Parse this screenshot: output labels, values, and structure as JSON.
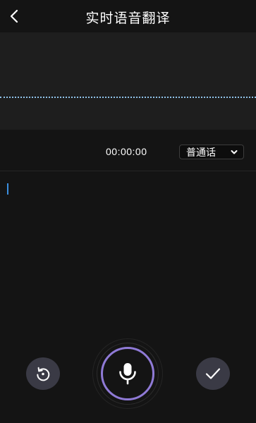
{
  "header": {
    "title": "实时语音翻译",
    "back_icon": "chevron-left-icon"
  },
  "waveform": {
    "color": "#8fc3ea"
  },
  "recorder": {
    "timer": "00:00:00",
    "language": "普通话",
    "language_chevron": "chevron-down-icon"
  },
  "transcript": {
    "text": "",
    "cursor_color": "#3b8fe0"
  },
  "controls": {
    "reset_icon": "reset-icon",
    "mic_icon": "microphone-icon",
    "confirm_icon": "checkmark-icon",
    "mic_ring_color": "#8f7ad6"
  }
}
